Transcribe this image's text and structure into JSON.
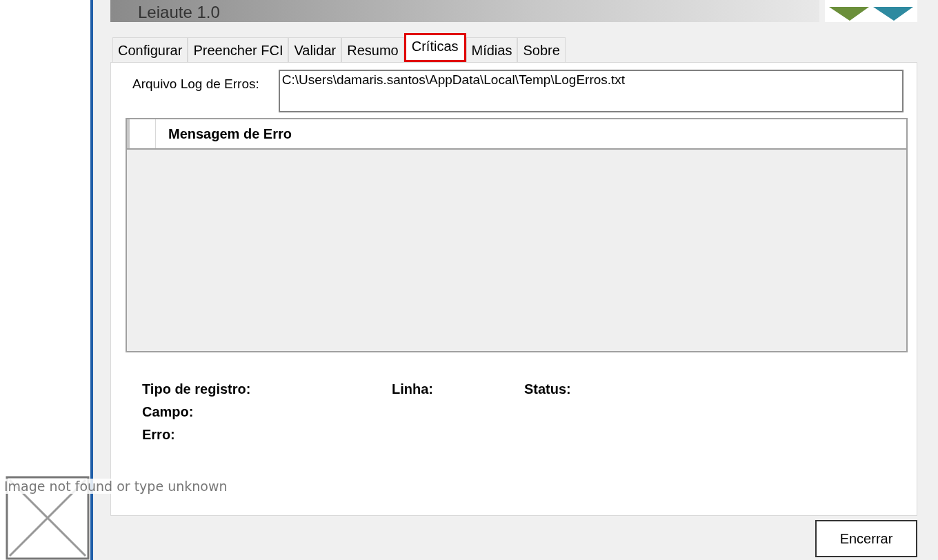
{
  "window": {
    "title": "Leiaute 1.0"
  },
  "tabs": [
    {
      "label": "Configurar",
      "selected": false
    },
    {
      "label": "Preencher FCI",
      "selected": false
    },
    {
      "label": "Validar",
      "selected": false
    },
    {
      "label": "Resumo",
      "selected": false
    },
    {
      "label": "Críticas",
      "selected": true
    },
    {
      "label": "Mídias",
      "selected": false
    },
    {
      "label": "Sobre",
      "selected": false
    }
  ],
  "log_file": {
    "label": "Arquivo Log de Erros:",
    "value": "C:\\Users\\damaris.santos\\AppData\\Local\\Temp\\LogErros.txt"
  },
  "table": {
    "columns": [
      "Mensagem de Erro"
    ]
  },
  "details": {
    "record_type": "Tipo de registro:",
    "line": "Linha:",
    "status": "Status:",
    "field": "Campo:",
    "error": "Erro:"
  },
  "broken_image": {
    "alt": "Image not found or type unknown"
  },
  "buttons": [
    "Encerrar"
  ]
}
